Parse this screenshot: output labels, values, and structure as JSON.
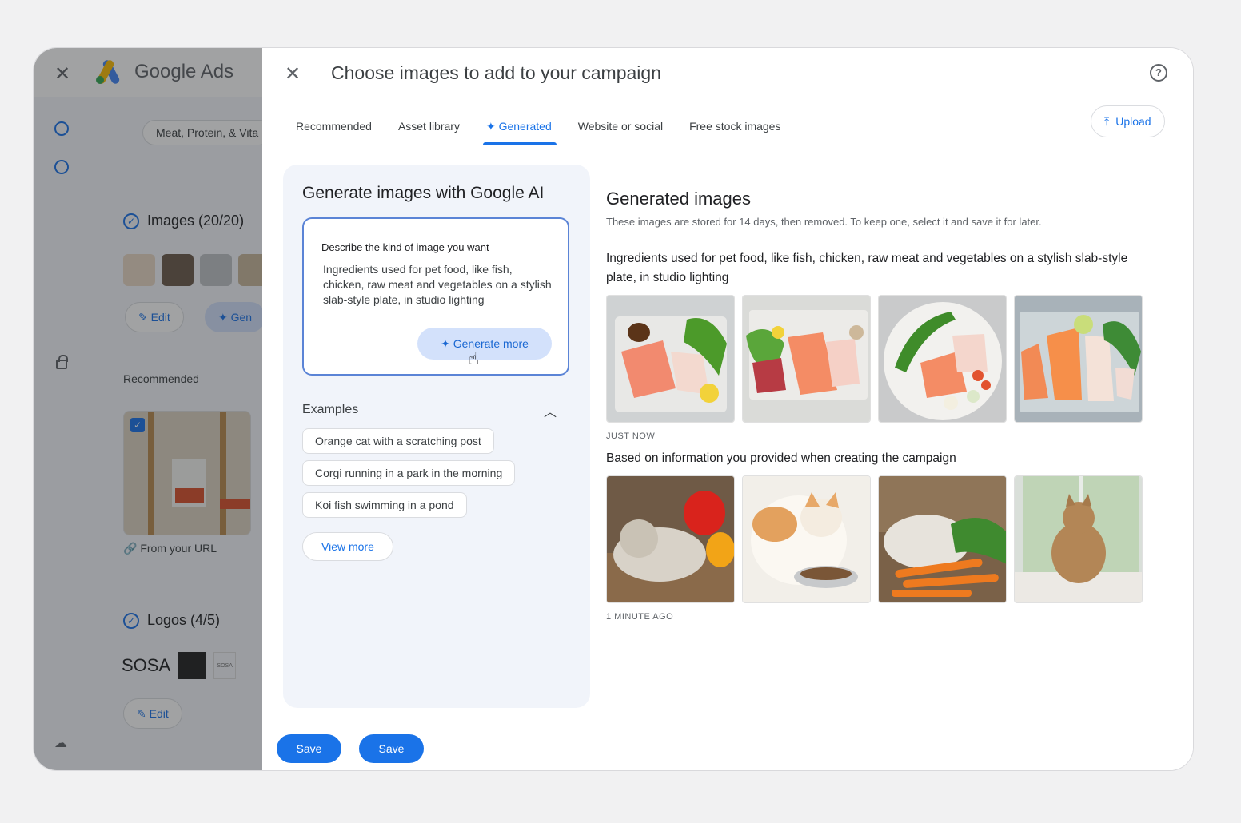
{
  "background_app": {
    "brand": "Google Ads",
    "campaign_chip": "Meat, Protein, & Vita",
    "images_section": "Images (20/20)",
    "edit_label": "Edit",
    "generate_label": "Gen",
    "recommended_label": "Recommended",
    "from_url_label": "From your URL",
    "logos_section": "Logos (4/5)",
    "logo_text": "SOSA",
    "logo_small": "SOSA",
    "logo_edit_label": "Edit"
  },
  "dialog": {
    "title": "Choose images to add to your campaign",
    "help_glyph": "?",
    "tabs": [
      {
        "label": "Recommended"
      },
      {
        "label": "Asset library"
      },
      {
        "label": "✦ Generated"
      },
      {
        "label": "Website or social"
      },
      {
        "label": "Free stock images"
      }
    ],
    "upload_label": "Upload",
    "panel": {
      "title": "Generate images with Google AI",
      "prompt_label": "Describe the kind of image you want",
      "prompt_text": "Ingredients used for pet food, like fish, chicken, raw meat and vegetables on a stylish slab-style plate, in studio lighting",
      "generate_more_label": "✦  Generate more",
      "examples_title": "Examples",
      "examples": [
        {
          "label": "Orange cat with a scratching post"
        },
        {
          "label": "Corgi running in a park in the morning"
        },
        {
          "label": "Koi fish swimming in a pond"
        }
      ],
      "view_more_label": "View more"
    },
    "generated": {
      "title": "Generated images",
      "note": "These images are stored for 14 days, then removed. To keep one, select it and save it for later.",
      "groups": [
        {
          "title": "Ingredients used for pet food, like fish, chicken, raw meat and vegetables on a stylish slab-style plate, in studio lighting",
          "time": "JUST NOW"
        },
        {
          "title": "Based on information you provided when creating the campaign",
          "time": "1 MINUTE AGO"
        }
      ]
    },
    "footer": {
      "save_label_1": "Save",
      "save_label_2": "Save"
    }
  },
  "colors": {
    "accent": "#1a73e8",
    "panel_bg": "#f1f4fa",
    "overlay": "#202124"
  }
}
